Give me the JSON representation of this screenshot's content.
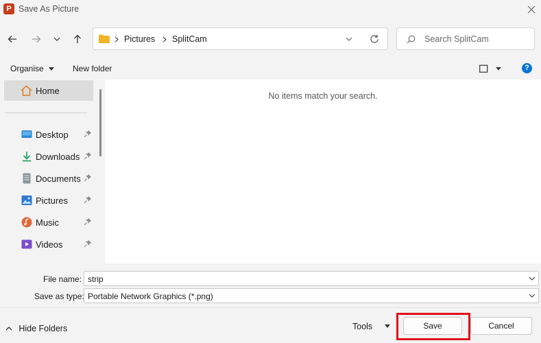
{
  "window": {
    "app_icon_letter": "P",
    "title": "Save As Picture"
  },
  "address": {
    "crumbs": [
      "Pictures",
      "SplitCam"
    ]
  },
  "search": {
    "placeholder": "Search SplitCam"
  },
  "commandbar": {
    "organise": "Organise",
    "new_folder": "New folder"
  },
  "nav": {
    "home": "Home",
    "items": [
      {
        "label": "Desktop",
        "icon": "desktop-icon",
        "color": "#2b88d8"
      },
      {
        "label": "Downloads",
        "icon": "download-icon",
        "color": "#1a9c5e"
      },
      {
        "label": "Documents",
        "icon": "documents-icon",
        "color": "#7a8590"
      },
      {
        "label": "Pictures",
        "icon": "pictures-icon",
        "color": "#2f7ad1"
      },
      {
        "label": "Music",
        "icon": "music-icon",
        "color": "#e0683c"
      },
      {
        "label": "Videos",
        "icon": "videos-icon",
        "color": "#7b4fc9"
      }
    ]
  },
  "content": {
    "empty_message": "No items match your search."
  },
  "form": {
    "file_name_label": "File name:",
    "file_name_value": "strip",
    "save_type_label": "Save as type:",
    "save_type_value": "Portable Network Graphics (*.png)"
  },
  "footer": {
    "hide_folders": "Hide Folders",
    "tools": "Tools",
    "save": "Save",
    "cancel": "Cancel"
  },
  "colors": {
    "highlight": "#e0101c",
    "help": "#0a74d4",
    "folder": "#f0b429"
  }
}
